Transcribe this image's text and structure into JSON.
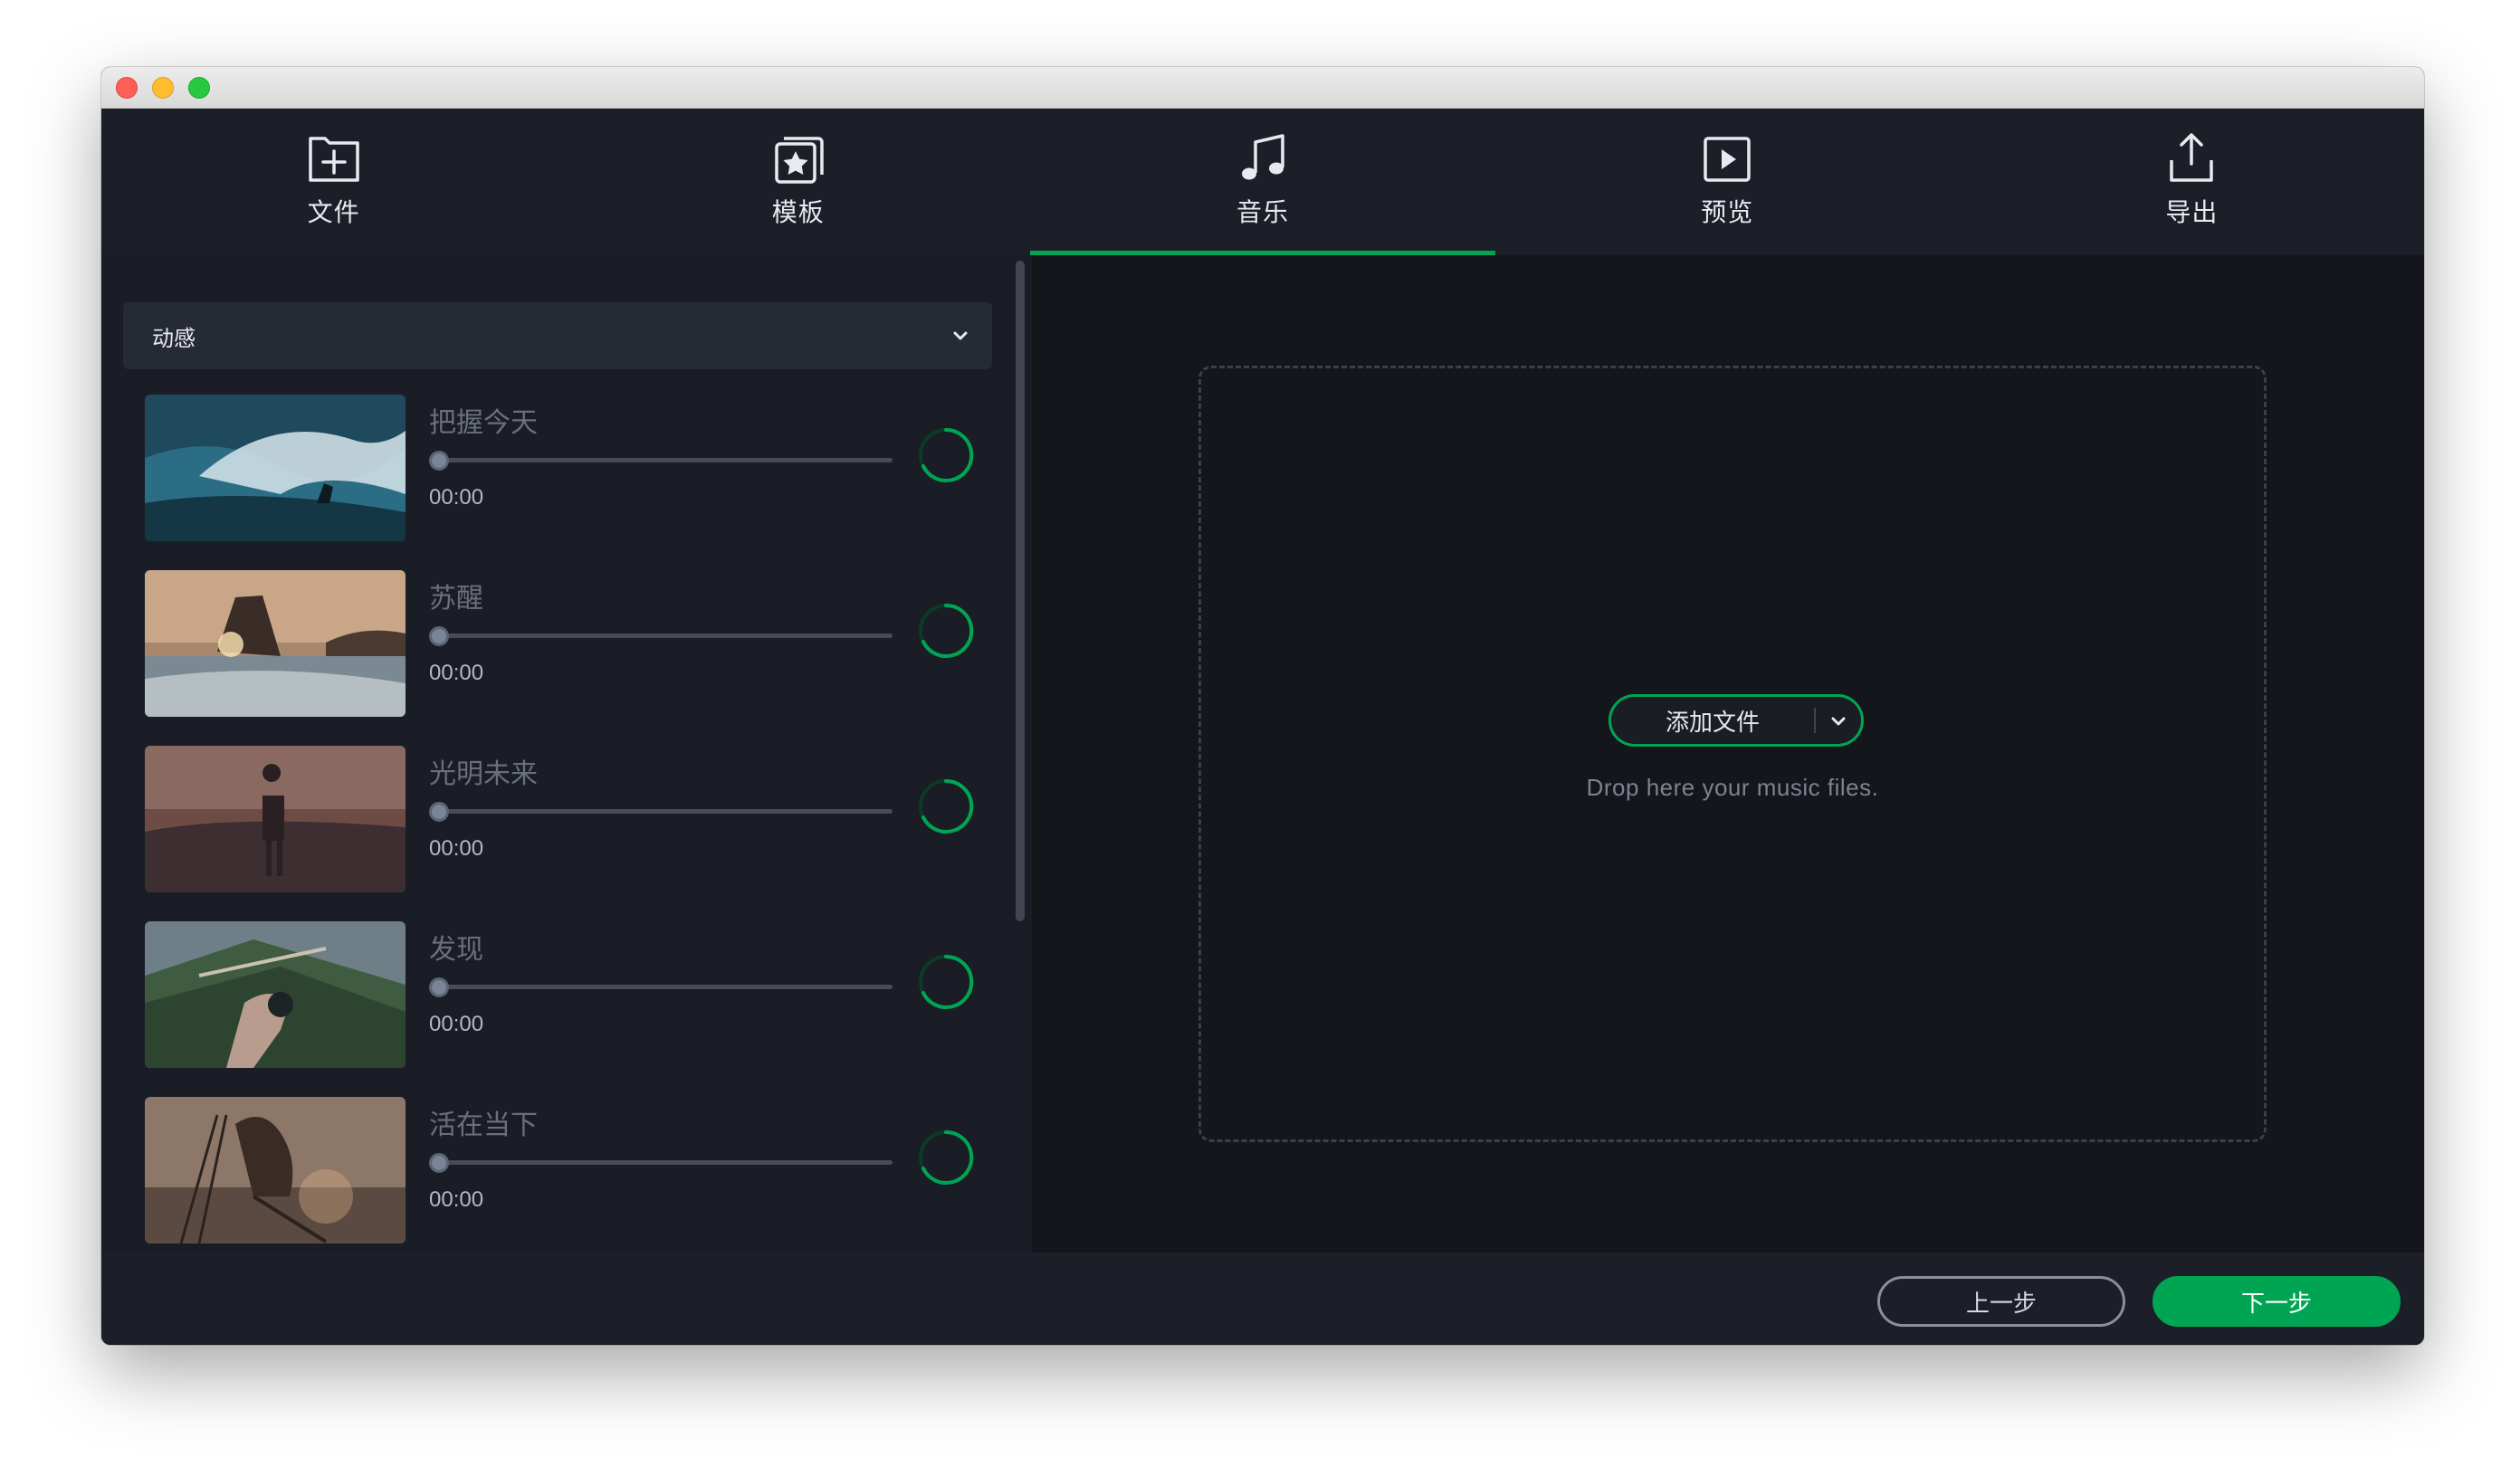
{
  "window": {
    "traffic_lights": [
      "close",
      "minimize",
      "zoom"
    ]
  },
  "nav": {
    "tabs": [
      {
        "label": "文件",
        "icon": "add-folder-icon"
      },
      {
        "label": "模板",
        "icon": "template-star-icon"
      },
      {
        "label": "音乐",
        "icon": "music-note-icon",
        "active": true
      },
      {
        "label": "预览",
        "icon": "play-preview-icon"
      },
      {
        "label": "导出",
        "icon": "export-upload-icon"
      }
    ]
  },
  "music": {
    "category": "动感",
    "tracks": [
      {
        "title": "把握今天",
        "time": "00:00",
        "thumb": "surfer"
      },
      {
        "title": "苏醒",
        "time": "00:00",
        "thumb": "sea-rocks-sunset"
      },
      {
        "title": "光明未来",
        "time": "00:00",
        "thumb": "hiker-sunset"
      },
      {
        "title": "发现",
        "time": "00:00",
        "thumb": "hand-compass-mountain"
      },
      {
        "title": "活在当下",
        "time": "00:00",
        "thumb": "girl-swing"
      }
    ]
  },
  "dropzone": {
    "add_button": "添加文件",
    "hint": "Drop here your music files."
  },
  "footer": {
    "prev": "上一步",
    "next": "下一步"
  },
  "colors": {
    "accent": "#00a554",
    "background": "#14161b",
    "panel": "#1c1f28"
  }
}
